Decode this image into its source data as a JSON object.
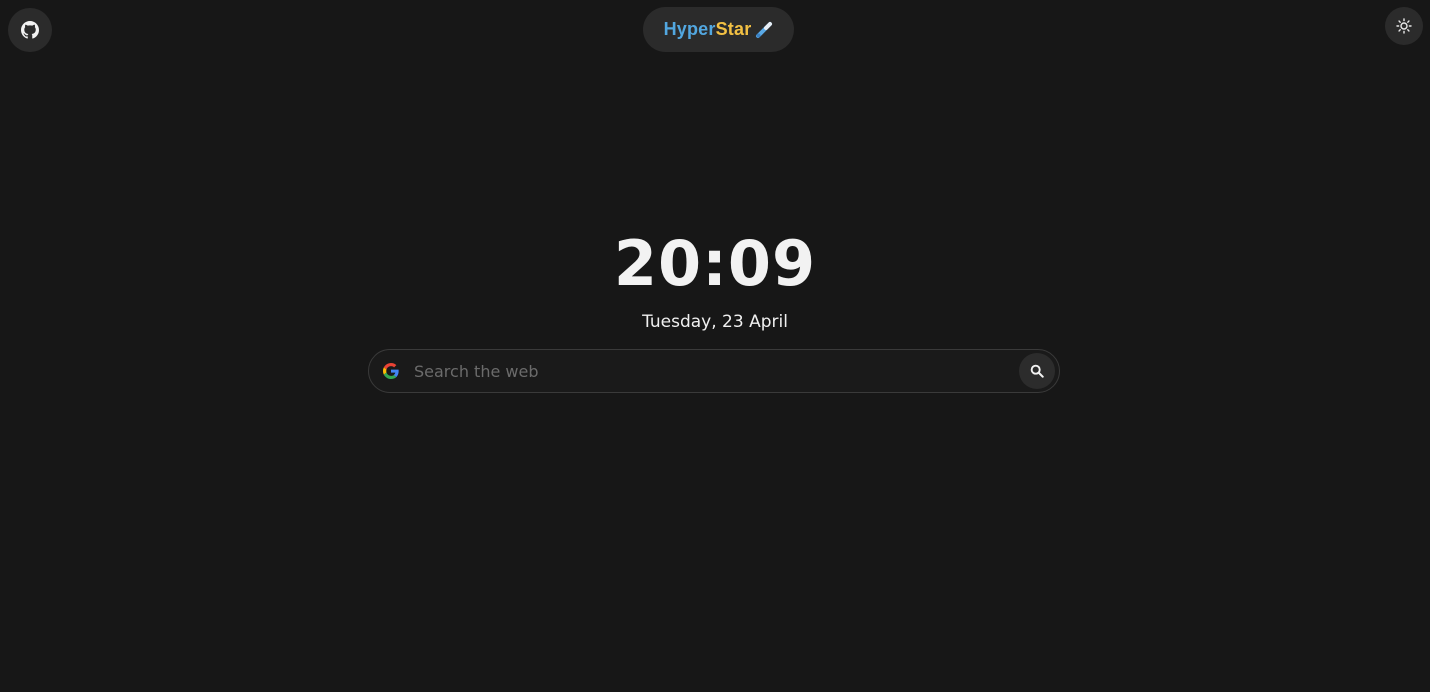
{
  "header": {
    "brand": {
      "part1": "Hyper",
      "part2": "Star",
      "icon": "paintbrush-icon",
      "part1_color": "#52a7e0",
      "part2_color": "#f2c043"
    },
    "github_icon": "github-icon",
    "theme_icon": "sun-icon"
  },
  "clock": {
    "time": "20:09",
    "date": "Tuesday, 23 April"
  },
  "search": {
    "placeholder": "Search the web",
    "value": "",
    "engine_icon": "google-icon",
    "submit_icon": "search-icon"
  },
  "colors": {
    "background": "#171717",
    "surface": "#2b2b2b",
    "text": "#f2f2f2"
  }
}
